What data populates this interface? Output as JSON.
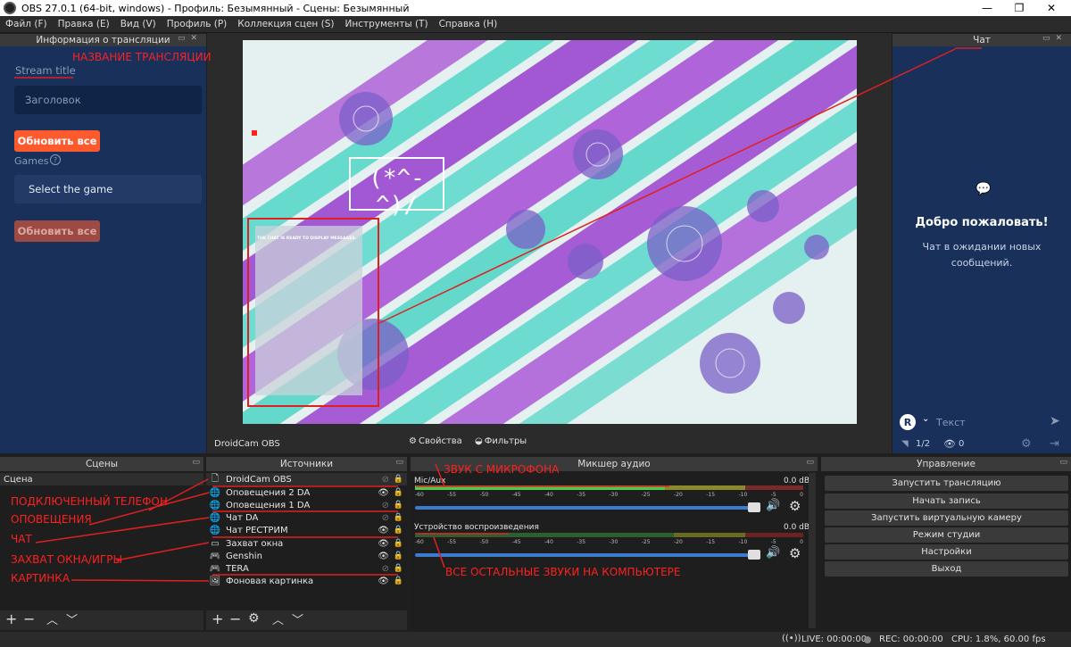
{
  "window": {
    "title": "OBS 27.0.1 (64-bit, windows) - Профиль: Безымянный - Сцены: Безымянный",
    "minimize": "—",
    "maximize": "❐",
    "close": "✕"
  },
  "menu": [
    "Файл (F)",
    "Правка (E)",
    "Вид (V)",
    "Профиль (P)",
    "Коллекция сцен (S)",
    "Инструменты (T)",
    "Справка (H)"
  ],
  "stream_info": {
    "dock_title": "Информация о трансляции",
    "title_label": "Stream title",
    "title_placeholder": "Заголовок",
    "update_button": "Обновить все",
    "games_label": "Games",
    "game_select": "Select the game",
    "update_button_2": "Обновить все",
    "accent_color": "#ff5a2e"
  },
  "preview": {
    "overlay_text": "(*^-^)/",
    "chat_widget_text": "THE CHAT IS READY TO DISPLAY MESSAGES."
  },
  "chat": {
    "dock_title": "Чат",
    "welcome_title": "Добро пожаловать!",
    "welcome_text": "Чат в ожидании новых сообщений.",
    "input_placeholder": "Текст",
    "avatar_letter": "R",
    "viewers_ratio": "1/2",
    "viewers_count": "0"
  },
  "source_toolbar": {
    "selected_source": "DroidCam OBS",
    "properties": "Свойства",
    "filters": "Фильтры"
  },
  "scenes": {
    "dock_title": "Сцены",
    "items": [
      "Сцена"
    ]
  },
  "sources": {
    "dock_title": "Источники",
    "items": [
      {
        "name": "DroidCam OBS",
        "icon": "file-icon",
        "visible": false
      },
      {
        "name": "Оповещения 2 DA",
        "icon": "globe-icon",
        "visible": true
      },
      {
        "name": "Оповещения 1 DA",
        "icon": "globe-icon",
        "visible": false
      },
      {
        "name": "Чат DA",
        "icon": "globe-icon",
        "visible": false
      },
      {
        "name": "Чат РЕСТРИМ",
        "icon": "globe-icon",
        "visible": true
      },
      {
        "name": "Захват окна",
        "icon": "window-icon",
        "visible": true
      },
      {
        "name": "Genshin",
        "icon": "gamepad-icon",
        "visible": true
      },
      {
        "name": "TERA",
        "icon": "gamepad-icon",
        "visible": false
      },
      {
        "name": "Фоновая картинка",
        "icon": "image-icon",
        "visible": true
      }
    ]
  },
  "mixer": {
    "dock_title": "Микшер аудио",
    "channels": [
      {
        "name": "Mic/Aux",
        "db": "0.0 dB",
        "volume": 0.99
      },
      {
        "name": "Устройство воспроизведения",
        "db": "0.0 dB",
        "volume": 0.99
      }
    ],
    "ticks": [
      "-60",
      "-55",
      "-50",
      "-45",
      "-40",
      "-35",
      "-30",
      "-25",
      "-20",
      "-15",
      "-10",
      "-5",
      "0"
    ]
  },
  "controls": {
    "dock_title": "Управление",
    "buttons": [
      "Запустить трансляцию",
      "Начать запись",
      "Запустить виртуальную камеру",
      "Режим студии",
      "Настройки",
      "Выход"
    ]
  },
  "status": {
    "live": "LIVE: 00:00:00",
    "rec": "REC: 00:00:00",
    "cpu": "CPU: 1.8%, 60.00 fps"
  },
  "annotations": {
    "stream_title": "НАЗВАНИЕ ТРАНСЛЯЦИИ",
    "mic": "ЗВУК С МИКРОФОНА",
    "phone": "ПОДКЛЮЧЕННЫЙ ТЕЛЕФОН",
    "alerts": "ОПОВЕЩЕНИЯ",
    "chat": "ЧАТ",
    "capture": "ЗАХВАТ ОКНА/ИГРЫ",
    "picture": "КАРТИНКА",
    "other_sounds": "ВСЕ ОСТАЛЬНЫЕ ЗВУКИ НА КОМПЬЮТЕРЕ",
    "color": "#ff2020"
  }
}
